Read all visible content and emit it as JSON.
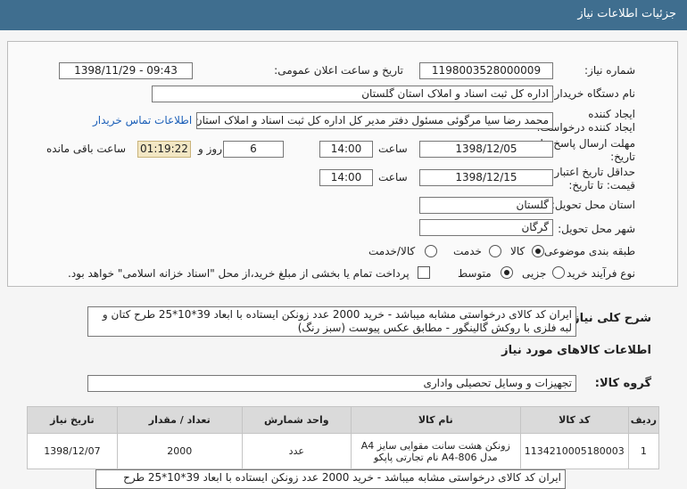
{
  "header": {
    "title": "جزئیات اطلاعات نیاز"
  },
  "form": {
    "need_number_label": "شماره نیاز:",
    "need_number": "1198003528000009",
    "announce_label": "تاریخ و ساعت اعلان عمومی:",
    "announce_value": "1398/11/29 - 09:43",
    "buyer_label": "نام دستگاه خریدار:",
    "buyer_value": "اداره کل ثبت اسناد و املاک استان گلستان",
    "creator_label": "ایجاد کننده درخواست:",
    "creator_value": "محمد رضا سیا مرگوئی مسئول دفتر مدیر کل اداره کل ثبت اسناد و املاک استان گلستان",
    "contact_link": "اطلاعات تماس خریدار",
    "deadline_label": "مهلت ارسال پاسخ: تا تاریخ:",
    "deadline_date": "1398/12/05",
    "time_label": "ساعت",
    "deadline_time": "14:00",
    "days_value": "6",
    "days_label": "روز و",
    "remaining_time": "01:19:22",
    "remaining_label": "ساعت باقی مانده",
    "validity_label": "حداقل تاریخ اعتبار قیمت: تا تاریخ:",
    "validity_date": "1398/12/15",
    "validity_time": "14:00",
    "province_label": "استان محل تحویل:",
    "province_value": "گلستان",
    "city_label": "شهر محل تحویل:",
    "city_value": "گرگان",
    "category_label": "طبقه بندی موضوعی:",
    "category_options": [
      "کالا",
      "خدمت",
      "کالا/خدمت"
    ],
    "category_selected": "کالا",
    "process_label": "نوع فرآیند خرید :",
    "process_options": [
      "جزیی",
      "متوسط"
    ],
    "process_selected": "متوسط",
    "payment_note": "پرداخت تمام یا بخشی از مبلغ خرید،از محل \"اسناد خزانه اسلامی\" خواهد بود."
  },
  "summary": {
    "label": "شرح کلی نیاز:",
    "text": "ایران کد کالای درخواستی مشابه میباشد - خرید 2000 عدد زونکن ایستاده با ابعاد 39*10*25  طرح کتان و لبه فلزی با روکش گالینگور - مطابق عکس پیوست (سبز رنگ)"
  },
  "goods_section_title": "اطلاعات کالاهای مورد نیاز",
  "group": {
    "label": "گروه کالا:",
    "value": "تجهیزات و وسایل تحصیلی واداری"
  },
  "table": {
    "headers": [
      "ردیف",
      "کد کالا",
      "نام کالا",
      "واحد شمارش",
      "تعداد / مقدار",
      "تاریخ نیاز"
    ],
    "rows": [
      [
        "1",
        "1134210005180003",
        "زونکن هشت سانت مقوایی سایز A4 مدل A4-806 نام تجارتی پاپکو",
        "عدد",
        "2000",
        "1398/12/07"
      ]
    ]
  },
  "bottom_note": "ایران کد کالای درخواستی مشابه میباشد - خرید 2000 عدد زونکن ایستاده با ابعاد 39*10*25  طرح"
}
